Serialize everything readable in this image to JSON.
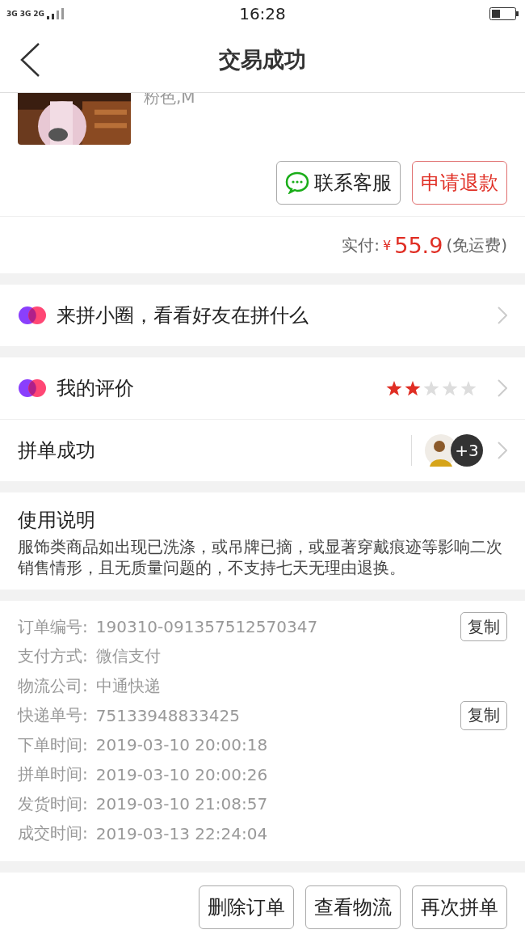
{
  "status_bar": {
    "carriers": [
      "3G",
      "3G",
      "2G"
    ],
    "time": "16:28"
  },
  "nav": {
    "title": "交易成功"
  },
  "product": {
    "spec": "粉色,M"
  },
  "product_actions": [
    {
      "label": "联系客服",
      "kind": "chat"
    },
    {
      "label": "申请退款",
      "kind": "refund"
    }
  ],
  "payment": {
    "label": "实付:",
    "currency": "¥",
    "amount": "55.9",
    "note": "(免运费)"
  },
  "circle": {
    "text": "来拼小圈，看看好友在拼什么"
  },
  "review": {
    "label": "我的评价",
    "stars": 2
  },
  "group": {
    "label": "拼单成功",
    "extra": "+3"
  },
  "instructions": {
    "title": "使用说明",
    "text": "服饰类商品如出现已洗涤，或吊牌已摘，或显著穿戴痕迹等影响二次销售情形，且无质量问题的，不支持七天无理由退换。"
  },
  "order_info": [
    {
      "label": "订单编号:",
      "value": "190310-091357512570347",
      "action": "复制"
    },
    {
      "label": "支付方式:",
      "value": "微信支付"
    },
    {
      "label": "物流公司:",
      "value": "中通快递"
    },
    {
      "label": "快递单号:",
      "value": "75133948833425",
      "action": "复制"
    },
    {
      "label": "下单时间:",
      "value": "2019-03-10 20:00:18"
    },
    {
      "label": "拼单时间:",
      "value": "2019-03-10 20:00:26"
    },
    {
      "label": "发货时间:",
      "value": "2019-03-10 21:08:57"
    },
    {
      "label": "成交时间:",
      "value": "2019-03-13 22:24:04"
    }
  ],
  "bottom_buttons": [
    "删除订单",
    "查看物流",
    "再次拼单"
  ]
}
